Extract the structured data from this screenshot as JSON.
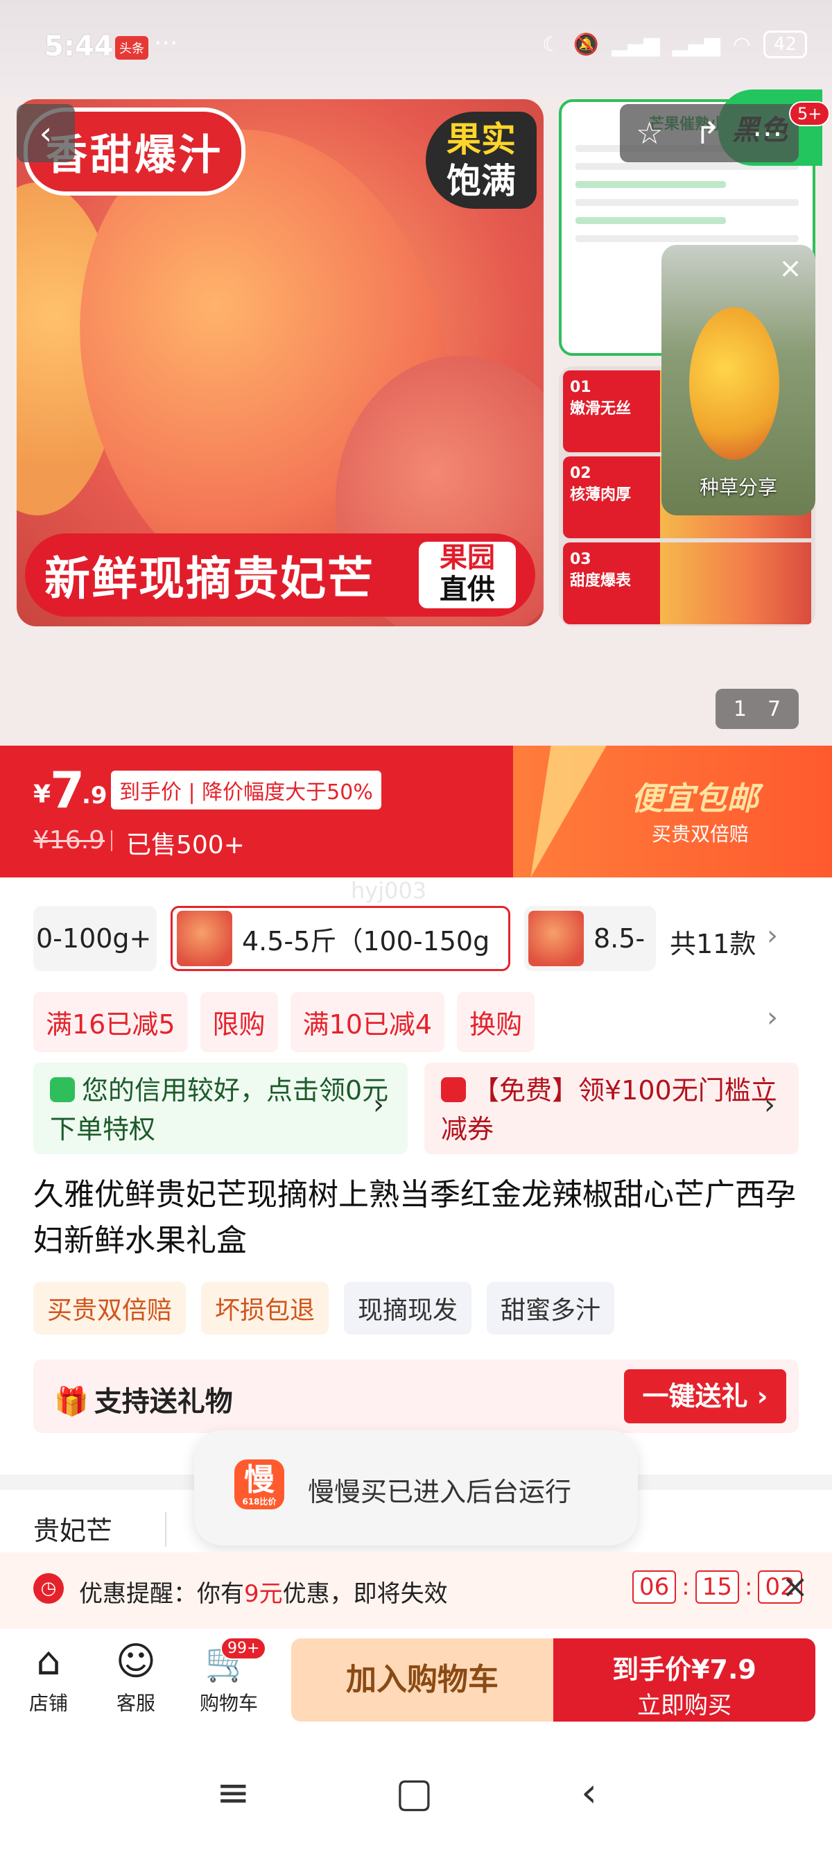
{
  "status_bar": {
    "time": "5:44",
    "app_badge": "头条",
    "dots": "···",
    "battery": "42",
    "icons": [
      "moon-icon",
      "mute-icon",
      "signal-hd-icon",
      "signal-hd-icon",
      "wifi-icon"
    ]
  },
  "header": {
    "back_icon": "back-arrow-icon",
    "favorite_icon": "star-icon",
    "share_icon": "share-icon",
    "more_icon": "more-icon",
    "more_badge": "5+"
  },
  "gallery": {
    "hero_tag_1": "香甜爆汁",
    "hero_tag_2_line1": "果实",
    "hero_tag_2_line2": "饱满",
    "hero_banner": "新鲜现摘贵妃芒",
    "hero_banner_badge_line1": "果园",
    "hero_banner_badge_line2": "直供",
    "thumb1_heading": "芒果催熟小",
    "thumb1_badge": "黑色",
    "thumb2_items": [
      {
        "num": "01",
        "label": "嫩滑无丝"
      },
      {
        "num": "02",
        "label": "核薄肉厚"
      },
      {
        "num": "03",
        "label": "甜度爆表"
      }
    ],
    "float_video_label": "种草分享",
    "pager_current": "1",
    "pager_total": "7"
  },
  "price": {
    "currency": "¥",
    "integer": "7",
    "decimal": ".9",
    "tag": "到手价 | 降价幅度大于50%",
    "original": "¥16.9",
    "sold": "已售500+",
    "promo_title": "便宜包邮",
    "promo_sub": "买贵双倍赔",
    "watermark": "hyj003"
  },
  "sku": {
    "items": [
      "0-100g+",
      "4.5-5斤（100-150g",
      "8.5-"
    ],
    "total": "共11款"
  },
  "promos": [
    "满16已减5",
    "限购",
    "满10已减4",
    "换购"
  ],
  "credit": {
    "left": "您的信用较好，点击领0元下单特权",
    "right": "【免费】领¥100无门槛立减券"
  },
  "product": {
    "title": "久雅优鲜贵妃芒现摘树上熟当季红金龙辣椒甜心芒广西孕妇新鲜水果礼盒",
    "tags": [
      "买贵双倍赔",
      "坏损包退",
      "现摘现发",
      "甜蜜多汁"
    ]
  },
  "gift": {
    "label": "支持送礼物",
    "button": "一键送礼 ›"
  },
  "spec": {
    "first": "贵妃芒"
  },
  "toast": {
    "app_char": "慢",
    "app_sub": "618比价",
    "message": "慢慢买已进入后台运行"
  },
  "reminder": {
    "prefix": "优惠提醒：你有",
    "amount": "9元",
    "suffix": "优惠，即将失效",
    "hh": "06",
    "mm": "15",
    "ss": "02"
  },
  "actions": {
    "shop": "店铺",
    "service": "客服",
    "cart": "购物车",
    "cart_badge": "99+",
    "add_cart": "加入购物车",
    "buy_line1": "到手价¥7.9",
    "buy_line2": "立即购买"
  },
  "colors": {
    "accent": "#e5222c",
    "promo_orange": "#ff5a2e"
  }
}
